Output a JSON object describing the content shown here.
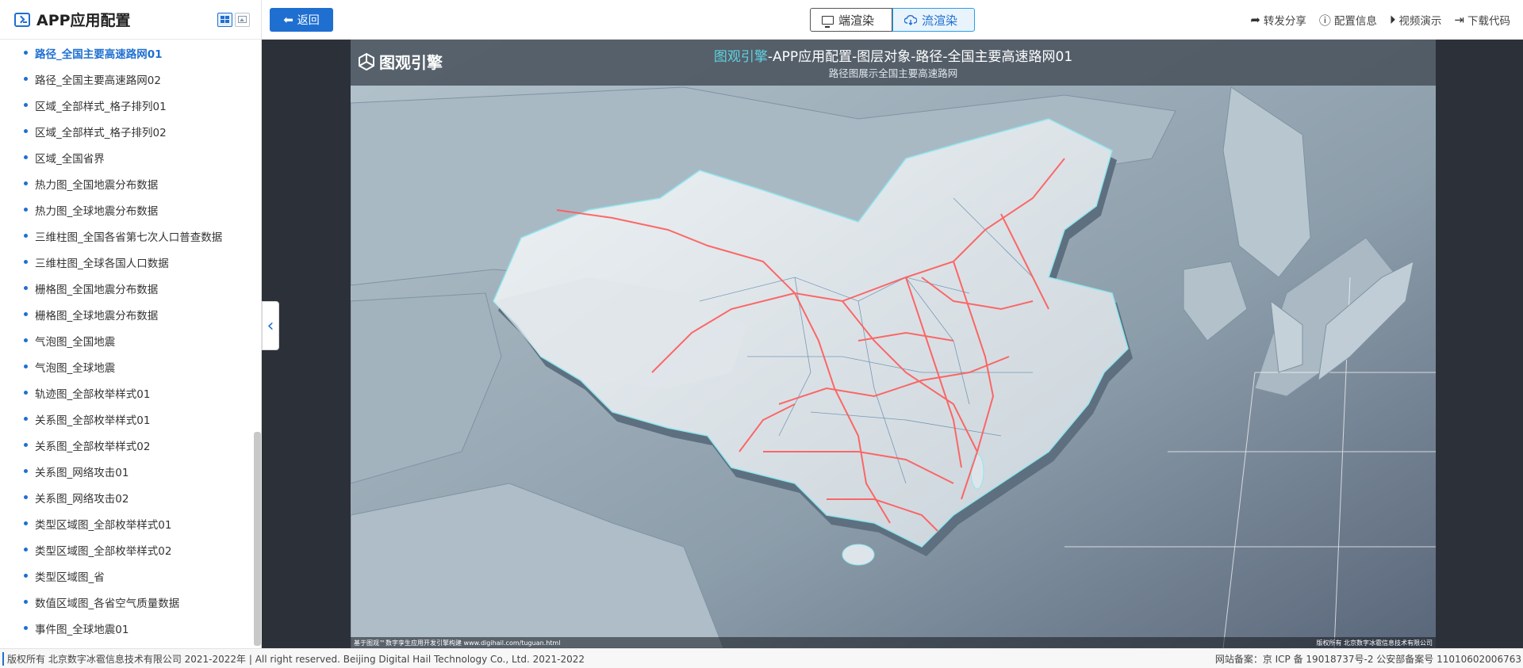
{
  "sidebar": {
    "title": "APP应用配置",
    "items": [
      {
        "label": "路径_全国主要高速路网01",
        "active": true
      },
      {
        "label": "路径_全国主要高速路网02"
      },
      {
        "label": "区域_全部样式_格子排列01"
      },
      {
        "label": "区域_全部样式_格子排列02"
      },
      {
        "label": "区域_全国省界"
      },
      {
        "label": "热力图_全国地震分布数据"
      },
      {
        "label": "热力图_全球地震分布数据"
      },
      {
        "label": "三维柱图_全国各省第七次人口普查数据"
      },
      {
        "label": "三维柱图_全球各国人口数据"
      },
      {
        "label": "栅格图_全国地震分布数据"
      },
      {
        "label": "栅格图_全球地震分布数据"
      },
      {
        "label": "气泡图_全国地震"
      },
      {
        "label": "气泡图_全球地震"
      },
      {
        "label": "轨迹图_全部枚举样式01"
      },
      {
        "label": "关系图_全部枚举样式01"
      },
      {
        "label": "关系图_全部枚举样式02"
      },
      {
        "label": "关系图_网络攻击01"
      },
      {
        "label": "关系图_网络攻击02"
      },
      {
        "label": "类型区域图_全部枚举样式01"
      },
      {
        "label": "类型区域图_全部枚举样式02"
      },
      {
        "label": "类型区域图_省"
      },
      {
        "label": "数值区域图_各省空气质量数据"
      },
      {
        "label": "事件图_全球地震01"
      }
    ]
  },
  "toolbar": {
    "back_label": "返回",
    "render_client": "端渲染",
    "render_stream": "流渲染",
    "actions": {
      "share": "转发分享",
      "config": "配置信息",
      "video": "视频演示",
      "download": "下载代码"
    }
  },
  "viewer": {
    "logo_text": "图观引擎",
    "title_accent": "图观引擎",
    "title_rest": "-APP应用配置-图层对象-路径-全国主要高速路网01",
    "subtitle": "路径图展示全国主要高速路网",
    "bottom_left": "基于图观™数字孪生应用开发引擎构建 www.digihail.com/tuguan.html",
    "bottom_right": "版权所有 北京数字冰雹信息技术有限公司"
  },
  "footer": {
    "left": "版权所有 北京数字冰雹信息技术有限公司 2021-2022年 | All right reserved. Beijing Digital Hail Technology Co., Ltd. 2021-2022",
    "right": "网站备案：京 ICP 备 19018737号-2 公安部备案号 11010602006763"
  },
  "colors": {
    "accent": "#1f6fd1",
    "route": "#ff5a5a",
    "title_accent": "#5fd2e0"
  }
}
